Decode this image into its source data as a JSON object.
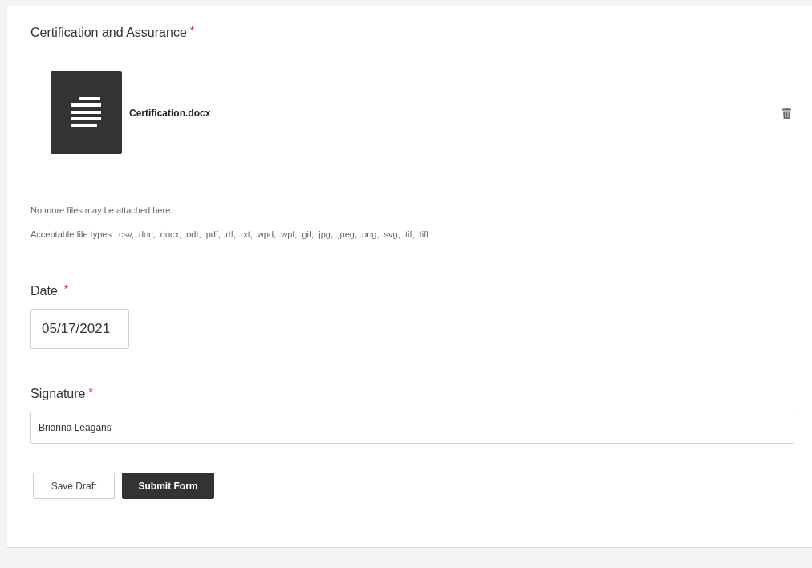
{
  "attachment": {
    "label": "Certification and Assurance",
    "required_mark": "*",
    "files": [
      {
        "name": "Certification.docx"
      }
    ],
    "notes": [
      "No more files may be attached here.",
      "Acceptable file types: .csv, .doc, .docx, .odt, .pdf, .rtf, .txt, .wpd, .wpf, .gif, .jpg, .jpeg, .png, .svg, .tif, .tiff"
    ]
  },
  "date": {
    "label": "Date",
    "required_mark": "*",
    "value": "05/17/2021"
  },
  "signature": {
    "label": "Signature",
    "required_mark": "*",
    "value": "Brianna Leagans"
  },
  "buttons": [
    {
      "label": "Save Draft",
      "kind": "secondary"
    },
    {
      "label": "Submit Form",
      "kind": "primary"
    }
  ]
}
